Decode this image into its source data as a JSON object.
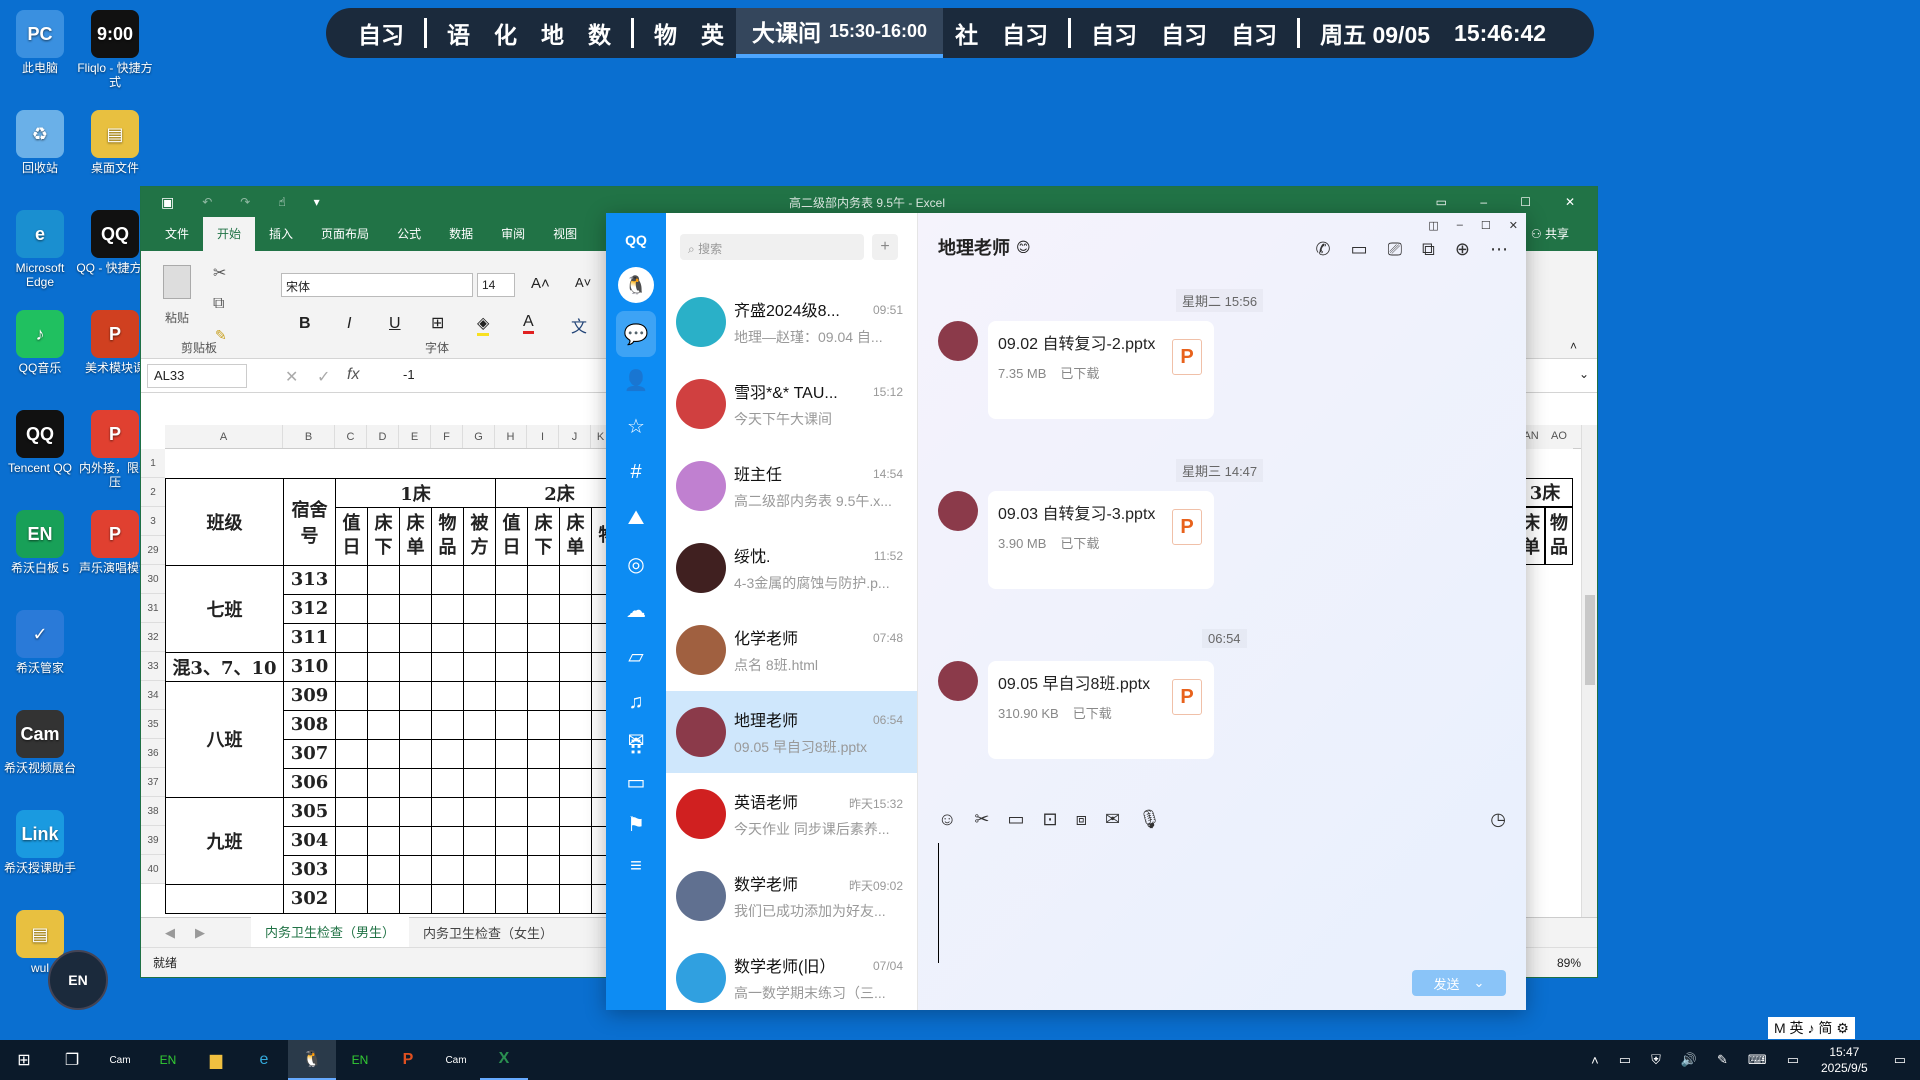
{
  "desktop_icons": [
    {
      "label": "此电脑",
      "color": "#3a90e0",
      "glyph": "PC"
    },
    {
      "label": "Fliqlo - 快捷方式",
      "color": "#111",
      "glyph": "9:00"
    },
    {
      "label": "回收站",
      "color": "#6ab0e8",
      "glyph": "♻"
    },
    {
      "label": "桌面文件",
      "color": "#e8c040",
      "glyph": "▤"
    },
    {
      "label": "Microsoft Edge",
      "color": "#1a8fd0",
      "glyph": "e"
    },
    {
      "label": "QQ - 快捷方式",
      "color": "#111",
      "glyph": "QQ"
    },
    {
      "label": "QQ音乐",
      "color": "#20c060",
      "glyph": "♪"
    },
    {
      "label": "美术模块课",
      "color": "#d04020",
      "glyph": "P"
    },
    {
      "label": "Tencent QQ",
      "color": "#111",
      "glyph": "QQ"
    },
    {
      "label": "内外接，限分压",
      "color": "#e04030",
      "glyph": "P"
    },
    {
      "label": "希沃白板 5",
      "color": "#18a058",
      "glyph": "EN"
    },
    {
      "label": "声乐演唱模课",
      "color": "#e04030",
      "glyph": "P"
    },
    {
      "label": "希沃管家",
      "color": "#2a7ad8",
      "glyph": "✓"
    },
    {
      "label": "希沃视频展台",
      "color": "#333",
      "glyph": "Cam"
    },
    {
      "label": "希沃授课助手",
      "color": "#1a9ae0",
      "glyph": "Link"
    },
    {
      "label": "wul",
      "color": "#e8c040",
      "glyph": "▤"
    }
  ],
  "schedule": {
    "before": [
      "自习",
      "|",
      "语",
      "化",
      "地",
      "数",
      "|",
      "物",
      "英"
    ],
    "current": {
      "label": "大课间",
      "time": "15:30-16:00"
    },
    "after": [
      "社",
      "自习",
      "|",
      "自习",
      "自习",
      "自习",
      "|"
    ],
    "date": "周五 09/05",
    "clock": "15:46:42"
  },
  "excel": {
    "title": "高二级部内务表 9.5午 - Excel",
    "tabs": [
      "文件",
      "开始",
      "插入",
      "页面布局",
      "公式",
      "数据",
      "审阅",
      "视图"
    ],
    "active_tab": "开始",
    "share_label": "共享",
    "clipboard_label": "剪贴板",
    "paste_label": "粘贴",
    "font_group_label": "字体",
    "font_name": "宋体",
    "font_size": "14",
    "name_box": "AL33",
    "formula": "-1",
    "columns": [
      "A",
      "B",
      "C",
      "D",
      "E",
      "F",
      "G",
      "H",
      "I",
      "J",
      "K"
    ],
    "right_columns": [
      "AN",
      "AO"
    ],
    "rows": [
      "1",
      "2",
      "3",
      "29",
      "30",
      "31",
      "32",
      "33",
      "34",
      "35",
      "36",
      "37",
      "38",
      "39",
      "40"
    ],
    "header_bed1": "1床",
    "header_bed2": "2床",
    "header_bed3": "3床",
    "col_class": "班级",
    "col_dorm": "宿舍号",
    "sub_cols": [
      "值日",
      "床下",
      "床单",
      "物品",
      "被方",
      "值日",
      "床下",
      "床单",
      "物"
    ],
    "right_sub_cols": [
      "床单",
      "物品"
    ],
    "title_partial": "高",
    "data_rows": [
      {
        "cls": "七班",
        "span": 3,
        "dorms": [
          "313",
          "312",
          "311"
        ]
      },
      {
        "cls": "混3、7、10",
        "span": 1,
        "dorms": [
          "310"
        ]
      },
      {
        "cls": "八班",
        "span": 4,
        "dorms": [
          "309",
          "308",
          "307",
          "306"
        ]
      },
      {
        "cls": "九班",
        "span": 3,
        "dorms": [
          "305",
          "304",
          "303"
        ]
      },
      {
        "cls": "",
        "span": 1,
        "dorms": [
          "302"
        ]
      }
    ],
    "sheet_tabs": [
      "内务卫生检查（男生）",
      "内务卫生检查（女生）"
    ],
    "status": "就绪",
    "zoom": "89%"
  },
  "qq": {
    "logo": "QQ",
    "search_placeholder": "搜索",
    "contact_name": "地理老师",
    "input_send": "发送",
    "conversations": [
      {
        "name": "齐盛2024级8...",
        "preview": "地理—赵瑾：09.04 自...",
        "time": "09:51",
        "color": "#2ab0c8"
      },
      {
        "name": "雪羽*&* TAU...",
        "preview": "今天下午大课间",
        "time": "15:12",
        "color": "#d04040"
      },
      {
        "name": "班主任",
        "preview": "高二级部内务表 9.5午.x...",
        "time": "14:54",
        "color": "#c080d0"
      },
      {
        "name": "绥忱.",
        "preview": "4-3金属的腐蚀与防护.p...",
        "time": "11:52",
        "color": "#402020"
      },
      {
        "name": "化学老师",
        "preview": "点名 8班.html",
        "time": "07:48",
        "color": "#a06040"
      },
      {
        "name": "地理老师",
        "preview": "09.05 早自习8班.pptx",
        "time": "06:54",
        "color": "#8b3a4a"
      },
      {
        "name": "英语老师",
        "preview": "今天作业 同步课后素养...",
        "time": "昨天15:32",
        "color": "#d02020"
      },
      {
        "name": "数学老师",
        "preview": "我们已成功添加为好友...",
        "time": "昨天09:02",
        "color": "#607090"
      },
      {
        "name": "数学老师(旧）",
        "preview": "高一数学期末练习（三...",
        "time": "07/04",
        "color": "#30a0e0"
      }
    ],
    "messages": [
      {
        "stamp": "星期二 15:56",
        "file": "09.02 自转复习-2.pptx",
        "size": "7.35 MB",
        "state": "已下载"
      },
      {
        "stamp": "星期三 14:47",
        "file": "09.03 自转复习-3.pptx",
        "size": "3.90 MB",
        "state": "已下载"
      },
      {
        "stamp": "06:54",
        "file": "09.05 早自习8班.pptx",
        "size": "310.90 KB",
        "state": "已下载"
      }
    ]
  },
  "ime": "M 英 ♪ 简 ⚙",
  "taskbar": {
    "time": "15:47",
    "date": "2025/9/5"
  }
}
